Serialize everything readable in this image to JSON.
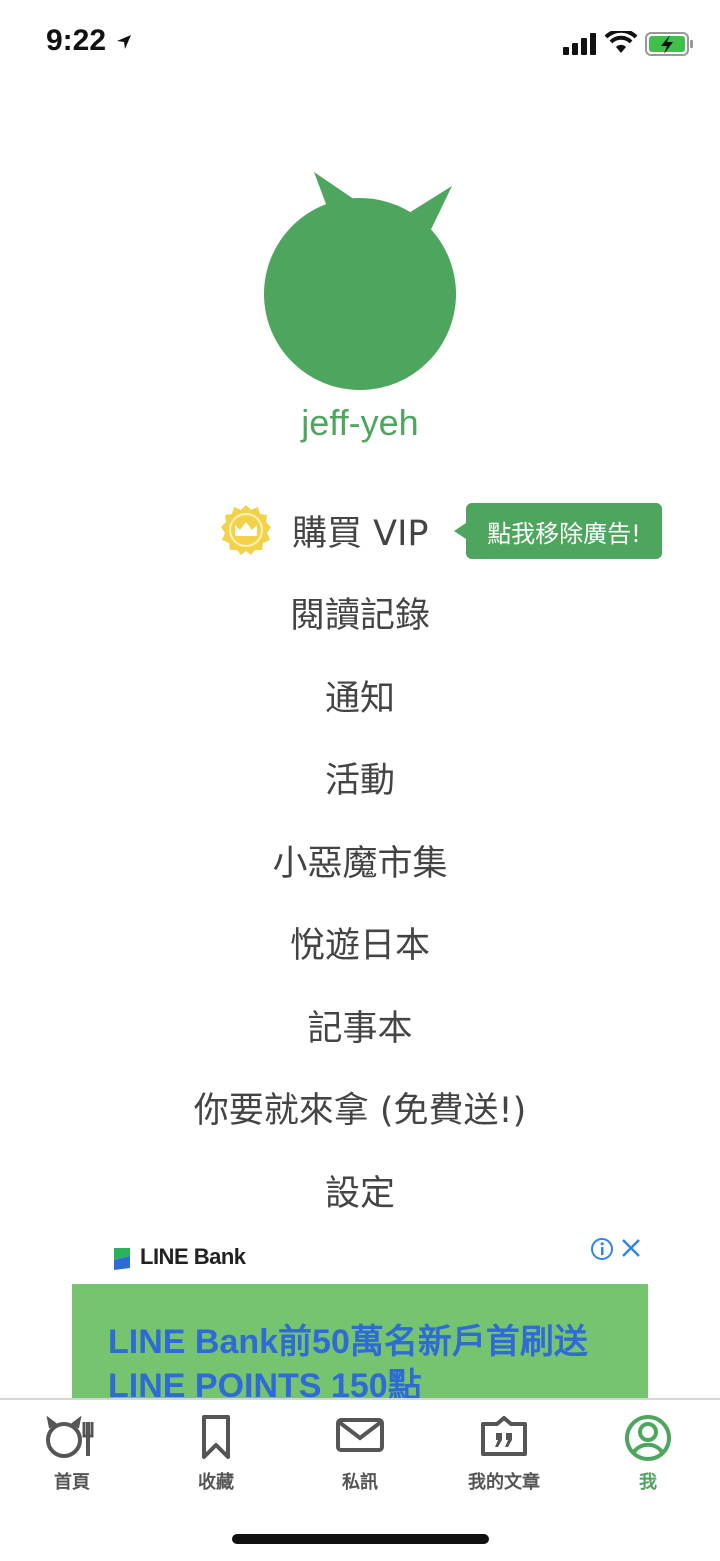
{
  "status": {
    "time": "9:22"
  },
  "profile": {
    "username": "jeff-yeh"
  },
  "vip": {
    "label": "購買 VIP",
    "bubble": "點我移除廣告!"
  },
  "menu": {
    "items": [
      {
        "label": "閱讀記錄"
      },
      {
        "label": "通知"
      },
      {
        "label": "活動"
      },
      {
        "label": "小惡魔市集"
      },
      {
        "label": "悅遊日本"
      },
      {
        "label": "記事本"
      },
      {
        "label": "你要就來拿 (免費送!)"
      },
      {
        "label": "設定"
      }
    ]
  },
  "ad": {
    "brand": "LINE Bank",
    "headline": "LINE Bank前50萬名新戶首刷送LINE POINTS 150點"
  },
  "tabs": [
    {
      "label": "首頁",
      "icon": "home-icon"
    },
    {
      "label": "收藏",
      "icon": "bookmark-icon"
    },
    {
      "label": "私訊",
      "icon": "mail-icon"
    },
    {
      "label": "我的文章",
      "icon": "article-icon"
    },
    {
      "label": "我",
      "icon": "profile-icon",
      "active": true
    }
  ],
  "colors": {
    "accent": "#4ea55d",
    "crown": "#f3d24a",
    "ad_bg": "#76c46f",
    "ad_text": "#2f6bd6"
  }
}
